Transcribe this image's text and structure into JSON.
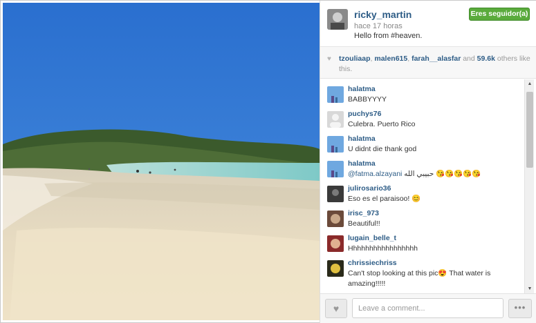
{
  "post": {
    "username": "ricky_martin",
    "time": "hace 17 horas",
    "caption": "Hello from #heaven.",
    "follow_label": "Eres seguidor(a)"
  },
  "likes": {
    "users": [
      "tzouliaap",
      "malen615",
      "farah__alasfar"
    ],
    "and_text": "and",
    "count": "59.6k",
    "suffix": "others like this."
  },
  "comments": [
    {
      "user": "halatma",
      "text": "BABBYYYY",
      "avatar": "blue-sky"
    },
    {
      "user": "puchys76",
      "text": "Culebra. Puerto Rico",
      "avatar": "default"
    },
    {
      "user": "halatma",
      "text": "U didnt die thank god",
      "avatar": "blue-sky"
    },
    {
      "user": "halatma",
      "mention": "@fatma.alzayani",
      "text": "حبيبي الله 😘😘😘😘😘",
      "avatar": "blue-sky"
    },
    {
      "user": "julirosario36",
      "text": "Eso es el paraisoo! 😊",
      "avatar": "dark"
    },
    {
      "user": "irisc_973",
      "text": "Beautiful!!",
      "avatar": "face"
    },
    {
      "user": "lugain_belle_t",
      "text": "Hhhhhhhhhhhhhhhhh",
      "avatar": "red"
    },
    {
      "user": "chrissiechriss",
      "text": "Can't stop looking at this pic😍 That water is amazing!!!!!",
      "avatar": "yellow"
    }
  ],
  "footer": {
    "comment_placeholder": "Leave a comment...",
    "more_label": "•••"
  },
  "colors": {
    "username": "#2d5c86",
    "follow_button": "#5aab3c"
  },
  "icons": [
    "heart-icon",
    "scroll-up-arrow-icon",
    "scroll-down-arrow-icon",
    "more-options-icon"
  ]
}
